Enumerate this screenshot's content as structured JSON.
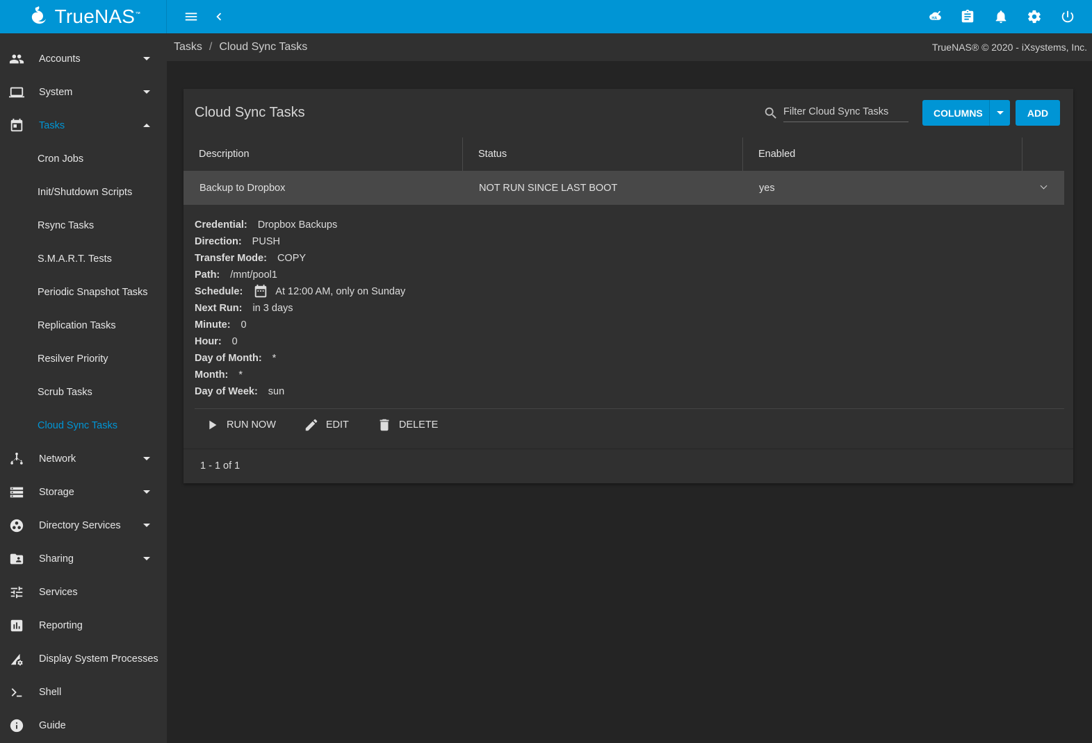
{
  "app": {
    "brand_name": "TrueNAS",
    "brand_mark": "™",
    "accent": "#0095d5"
  },
  "topbar": {
    "icons": [
      "menu-icon",
      "chevron-left-icon",
      "ha-status-icon",
      "clipboard-tasks-icon",
      "bell-icon",
      "gear-icon",
      "power-icon"
    ]
  },
  "sidebar": {
    "items": [
      {
        "label": "Accounts",
        "icon": "people-icon",
        "caret": "down"
      },
      {
        "label": "System",
        "icon": "laptop-icon",
        "caret": "down"
      },
      {
        "label": "Tasks",
        "icon": "calendar-icon",
        "caret": "up",
        "expanded": true
      },
      {
        "label": "Network",
        "icon": "network-icon",
        "caret": "down"
      },
      {
        "label": "Storage",
        "icon": "storage-icon",
        "caret": "down"
      },
      {
        "label": "Directory Services",
        "icon": "directory-icon",
        "caret": "down"
      },
      {
        "label": "Sharing",
        "icon": "shared-folder-icon",
        "caret": "down"
      },
      {
        "label": "Services",
        "icon": "tune-icon"
      },
      {
        "label": "Reporting",
        "icon": "chart-icon"
      },
      {
        "label": "Display System Processes",
        "icon": "processes-icon"
      },
      {
        "label": "Shell",
        "icon": "console-icon"
      },
      {
        "label": "Guide",
        "icon": "info-icon"
      }
    ],
    "tasks_children": [
      "Cron Jobs",
      "Init/Shutdown Scripts",
      "Rsync Tasks",
      "S.M.A.R.T. Tests",
      "Periodic Snapshot Tasks",
      "Replication Tasks",
      "Resilver Priority",
      "Scrub Tasks",
      "Cloud Sync Tasks"
    ],
    "current": "Cloud Sync Tasks"
  },
  "breadcrumb": {
    "parent": "Tasks",
    "separator": "/",
    "current": "Cloud Sync Tasks"
  },
  "copyright": "TrueNAS® © 2020 - iXsystems, Inc.",
  "card": {
    "title": "Cloud Sync Tasks",
    "filter_placeholder": "Filter Cloud Sync Tasks",
    "columns_label": "COLUMNS",
    "add_label": "ADD",
    "columns": [
      "Description",
      "Status",
      "Enabled"
    ],
    "row": {
      "description": "Backup to Dropbox",
      "status": "NOT RUN SINCE LAST BOOT",
      "enabled": "yes"
    },
    "details": [
      {
        "key": "Credential:",
        "value": "Dropbox Backups"
      },
      {
        "key": "Direction:",
        "value": "PUSH"
      },
      {
        "key": "Transfer Mode:",
        "value": "COPY"
      },
      {
        "key": "Path:",
        "value": "/mnt/pool1"
      },
      {
        "key": "Schedule:",
        "value": "At 12:00 AM, only on Sunday"
      },
      {
        "key": "Next Run:",
        "value": "in 3 days"
      },
      {
        "key": "Minute:",
        "value": "0"
      },
      {
        "key": "Hour:",
        "value": "0"
      },
      {
        "key": "Day of Month:",
        "value": "*"
      },
      {
        "key": "Month:",
        "value": "*"
      },
      {
        "key": "Day of Week:",
        "value": "sun"
      }
    ],
    "actions": {
      "run": "RUN NOW",
      "edit": "EDIT",
      "delete": "DELETE"
    },
    "pager": "1 - 1 of 1"
  }
}
